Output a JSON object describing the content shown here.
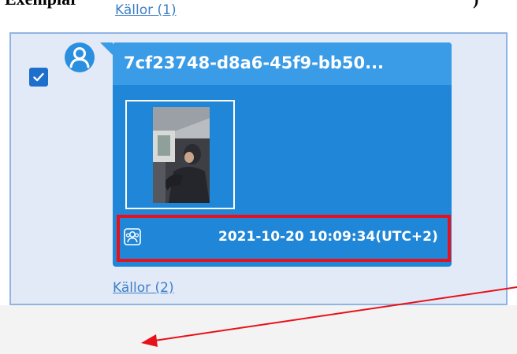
{
  "overlay": {
    "top_text_left": "Exemplar",
    "top_text_right": ")"
  },
  "previous_sources_label": "Källor (1)",
  "card": {
    "checkbox_checked": true,
    "title": "7cf23748-d8a6-45f9-bb50...",
    "icons": {
      "avatar": "user-avatar-icon",
      "contact": "contact-group-icon",
      "check": "checkmark-icon"
    },
    "timestamp": "2021-10-20 10:09:34(UTC+2)",
    "sources_label": "Källor (2)"
  },
  "colors": {
    "bubble": "#1f86d8",
    "bubble_header": "#3a9be6",
    "card_background": "#e3eaf7",
    "card_border": "#8fb5e3",
    "highlight_box": "#e8101a",
    "arrow": "#e8101a",
    "link": "#3d7fc7"
  }
}
